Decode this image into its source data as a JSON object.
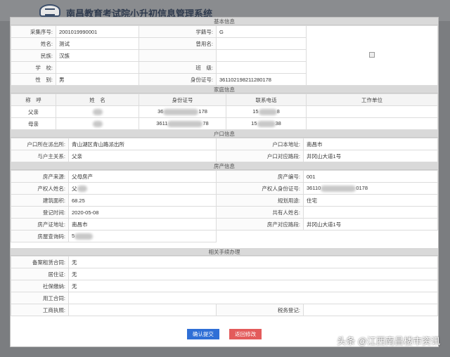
{
  "app": {
    "title": "南昌教育考试院小升初信息管理系统"
  },
  "basic": {
    "title": "基本信息",
    "caiji_label": "采集序号:",
    "caiji_value": "2001019990001",
    "xueji_label": "学籍号:",
    "xueji_value": "G",
    "name_label": "姓名:",
    "name_value": "测试",
    "used_name_label": "曾用名:",
    "used_name_value": "",
    "nation_label": "民族:",
    "nation_value": "汉族",
    "school_label": "学　校:",
    "school_value": "",
    "class_label": "班　级:",
    "class_value": "",
    "gender_label": "性　别:",
    "gender_value": "男",
    "id_label": "身份证号:",
    "id_value": "361102198211280178"
  },
  "family": {
    "title": "家庭信息",
    "headers": [
      "称　呼",
      "姓　名",
      "身份证号",
      "联系电话",
      "工作单位"
    ],
    "rows": [
      {
        "relation": "父亲",
        "name": "",
        "id_prefix": "36",
        "id_suffix": "178",
        "phone_prefix": "15",
        "phone_suffix": "8",
        "work": ""
      },
      {
        "relation": "母亲",
        "name": "",
        "id_prefix": "3611",
        "id_suffix": "78",
        "phone_prefix": "15",
        "phone_suffix": "38",
        "work": ""
      }
    ]
  },
  "hukou": {
    "title": "户口信息",
    "police_label": "户口所在派出所:",
    "police_value": "青山湖区青山路派出所",
    "addr_label": "户口本地址:",
    "addr_value": "南昌市",
    "relation_label": "与户主关系:",
    "relation_value": "父亲",
    "road_label": "户口对应路段:",
    "road_value": "井冈山大道1号"
  },
  "house": {
    "title": "房产信息",
    "source_label": "房产来源:",
    "source_value": "父母房产",
    "no_label": "房产编号:",
    "no_value": "001",
    "owner_label": "产权人姓名:",
    "owner_value": "父",
    "owner_id_label": "产权人身份证号:",
    "owner_id_prefix": "36110",
    "owner_id_suffix": "0178",
    "area_label": "建筑面积:",
    "area_value": "68.25",
    "usage_label": "规划用途:",
    "usage_value": "住宅",
    "reg_label": "登记时间:",
    "reg_value": "2020-05-08",
    "co_label": "共有人姓名:",
    "co_value": "",
    "cert_addr_label": "房产证地址:",
    "cert_addr_value": "南昌市",
    "road_label": "房产对应路段:",
    "road_value": "井冈山大道1号",
    "query_label": "房屋查询码:",
    "query_value": "5"
  },
  "related": {
    "title": "相关手续办理",
    "rows": [
      {
        "label": "备案租赁合同:",
        "value": "无"
      },
      {
        "label": "居住证:",
        "value": "无"
      },
      {
        "label": "社保缴纳:",
        "value": "无"
      },
      {
        "label": "用工合同:",
        "value": ""
      }
    ],
    "biz_label": "工商执照:",
    "biz_value": "",
    "tax_label": "税务登记:",
    "tax_value": ""
  },
  "buttons": {
    "confirm": "确认提交",
    "back": "返回修改"
  },
  "watermark": "头条 @江西南昌楼市资讯"
}
